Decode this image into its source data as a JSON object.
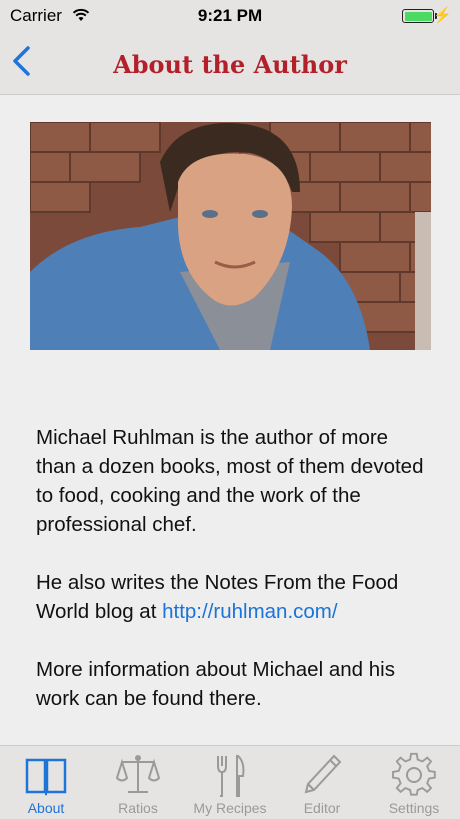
{
  "status_bar": {
    "carrier": "Carrier",
    "time": "9:21 PM"
  },
  "nav": {
    "title": "About the Author",
    "back_icon": "chevron-left-icon",
    "accent_color": "#b3202a"
  },
  "photo": {
    "alt": "Michael Ruhlman"
  },
  "bio": {
    "para1": "Michael Ruhlman is the author of more than a dozen books, most of them devoted to food, cooking and the work of the professional chef.",
    "para2_text": "He also writes the Notes From the Food World blog at ",
    "para2_link": "http://ruhlman.com/",
    "para3": "More information about Michael and his work can be found there."
  },
  "tabs": [
    {
      "label": "About",
      "icon": "book-icon",
      "active": true
    },
    {
      "label": "Ratios",
      "icon": "scales-icon",
      "active": false
    },
    {
      "label": "My Recipes",
      "icon": "fork-knife-icon",
      "active": false
    },
    {
      "label": "Editor",
      "icon": "pencil-icon",
      "active": false
    },
    {
      "label": "Settings",
      "icon": "gear-icon",
      "active": false
    }
  ],
  "colors": {
    "tab_active": "#1f74d8",
    "tab_inactive": "#9a9a9a",
    "link": "#1a73d8"
  }
}
